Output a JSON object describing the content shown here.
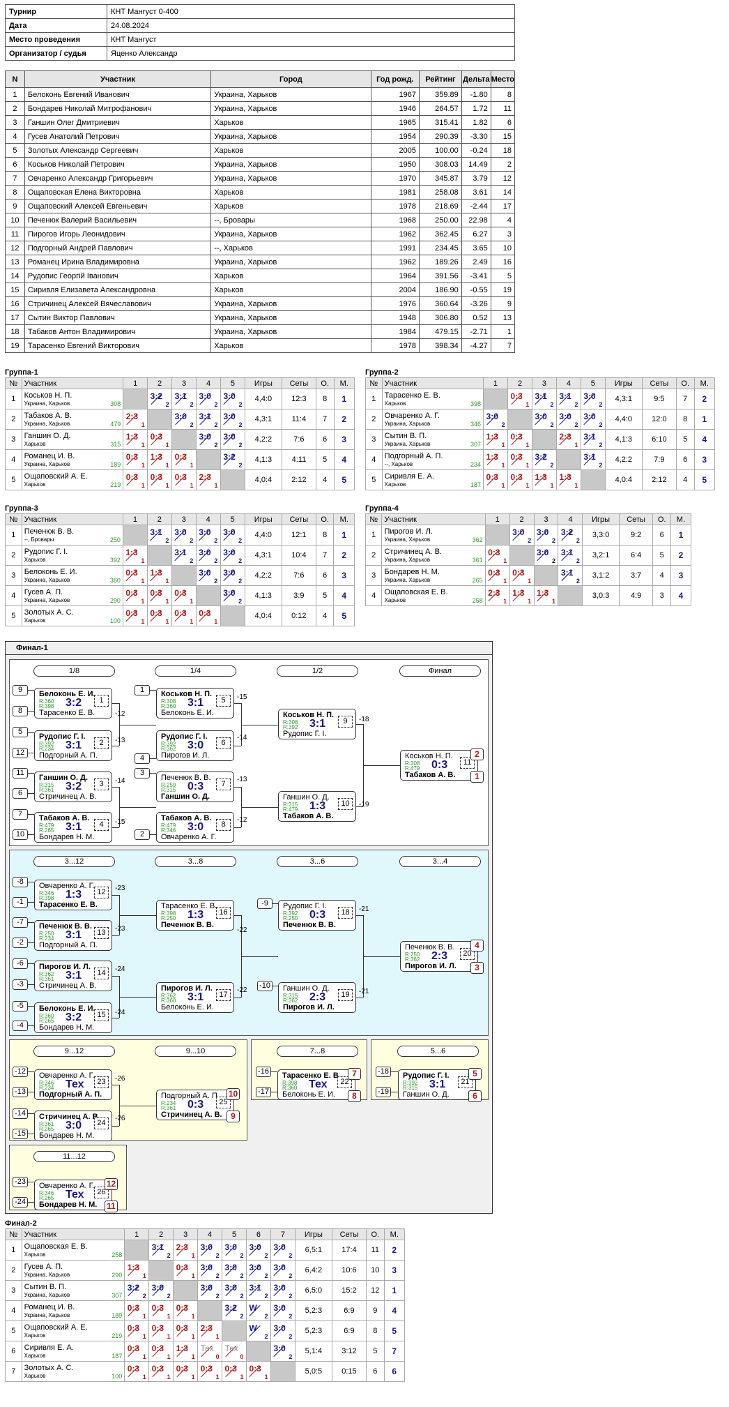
{
  "info": [
    {
      "k": "Турнир",
      "v": "КНТ Мангуст 0-400"
    },
    {
      "k": "Дата",
      "v": "24.08.2024"
    },
    {
      "k": "Место проведения",
      "v": "КНТ Мангуст"
    },
    {
      "k": "Организатор / судья",
      "v": "Яценко Александр"
    }
  ],
  "players_headers": [
    "N",
    "Участник",
    "Город",
    "Год рожд.",
    "Рейтинг",
    "Дельта",
    "Место"
  ],
  "players": [
    [
      "1",
      "Белоконь Евгений Иванович",
      "Украина, Харьков",
      "1967",
      "359.89",
      "-1.80",
      "8"
    ],
    [
      "2",
      "Бондарев Николай Митрофанович",
      "Украина, Харьков",
      "1946",
      "264.57",
      "1.72",
      "11"
    ],
    [
      "3",
      "Ганшин Олег Дмитриевич",
      "Харьков",
      "1965",
      "315.41",
      "1.82",
      "6"
    ],
    [
      "4",
      "Гусев Анатолий Петрович",
      "Украина, Харьков",
      "1954",
      "290.39",
      "-3.30",
      "15"
    ],
    [
      "5",
      "Золотых Александр Сергеевич",
      "Харьков",
      "2005",
      "100.00",
      "-0.24",
      "18"
    ],
    [
      "6",
      "Коськов Николай Петрович",
      "Украина, Харьков",
      "1950",
      "308.03",
      "14.49",
      "2"
    ],
    [
      "7",
      "Овчаренко Александр Григорьевич",
      "Украина, Харьков",
      "1970",
      "345.87",
      "3.79",
      "12"
    ],
    [
      "8",
      "Ощаповская Елена Викторовна",
      "Харьков",
      "1981",
      "258.08",
      "3.61",
      "14"
    ],
    [
      "9",
      "Ощаповский Алексей Евгеньевич",
      "Харьков",
      "1978",
      "218.69",
      "-2.44",
      "17"
    ],
    [
      "10",
      "Печенюк Валерий Васильевич",
      "--, Бровары",
      "1968",
      "250.00",
      "22.98",
      "4"
    ],
    [
      "11",
      "Пирогов Игорь Леонидович",
      "Украина, Харьков",
      "1962",
      "362.45",
      "6.27",
      "3"
    ],
    [
      "12",
      "Подгорный Андрей Павлович",
      "--, Харьков",
      "1991",
      "234.45",
      "3.65",
      "10"
    ],
    [
      "13",
      "Романец Ирина Владимировна",
      "Украина, Харьков",
      "1962",
      "189.26",
      "2.49",
      "16"
    ],
    [
      "14",
      "Рудопис Георгій Іванович",
      "Харьков",
      "1964",
      "391.56",
      "-3.41",
      "5"
    ],
    [
      "15",
      "Сиривля Елизавета Александровна",
      "Харьков",
      "2004",
      "186.90",
      "-0.55",
      "19"
    ],
    [
      "16",
      "Стричинец Алексей Вячеславович",
      "Украина, Харьков",
      "1976",
      "360.64",
      "-3.26",
      "9"
    ],
    [
      "17",
      "Сытин Виктор Павлович",
      "Украина, Харьков",
      "1948",
      "306.80",
      "0.52",
      "13"
    ],
    [
      "18",
      "Табаков Антон Владимирович",
      "Украина, Харьков",
      "1984",
      "479.15",
      "-2.71",
      "1"
    ],
    [
      "19",
      "Тарасенко Евгений Викторович",
      "Харьков",
      "1978",
      "398.34",
      "-4.27",
      "7"
    ]
  ],
  "grp_head": {
    "n": "№",
    "p": "Участник",
    "g": "Игры",
    "s": "Сеты",
    "o": "О.",
    "m": "М."
  },
  "groups": [
    {
      "title": "Группа-1",
      "cols": [
        "1",
        "2",
        "3",
        "4",
        "5"
      ],
      "rows": [
        {
          "n": "1",
          "name": "Коськов Н. П.",
          "city": "Украина, Харьков",
          "r": "308",
          "cells": [
            "",
            "3:2|2",
            "3:1|2",
            "3:0|2",
            "3:0|2"
          ],
          "g": "4,4:0",
          "s": "12:3",
          "o": "8",
          "m": "1"
        },
        {
          "n": "2",
          "name": "Табаков А. В.",
          "city": "Украина, Харьков",
          "r": "479",
          "cells": [
            "2:3|1",
            "",
            "3:0|2",
            "3:1|2",
            "3:0|2"
          ],
          "g": "4,3:1",
          "s": "11:4",
          "o": "7",
          "m": "2"
        },
        {
          "n": "3",
          "name": "Ганшин О. Д.",
          "city": "Харьков",
          "r": "315",
          "cells": [
            "1:3|1",
            "0:3|1",
            "",
            "3:0|2",
            "3:0|2"
          ],
          "g": "4,2:2",
          "s": "7:6",
          "o": "6",
          "m": "3"
        },
        {
          "n": "4",
          "name": "Романец И. В.",
          "city": "Украина, Харьков",
          "r": "189",
          "cells": [
            "0:3|1",
            "1:3|1",
            "0:3|1",
            "",
            "3:2|2"
          ],
          "g": "4,1:3",
          "s": "4:11",
          "o": "5",
          "m": "4"
        },
        {
          "n": "5",
          "name": "Ощаповский А. Е.",
          "city": "Харьков",
          "r": "219",
          "cells": [
            "0:3|1",
            "0:3|1",
            "0:3|1",
            "2:3|1",
            ""
          ],
          "g": "4,0:4",
          "s": "2:12",
          "o": "4",
          "m": "5"
        }
      ]
    },
    {
      "title": "Группа-2",
      "cols": [
        "1",
        "2",
        "3",
        "4",
        "5"
      ],
      "rows": [
        {
          "n": "1",
          "name": "Тарасенко Е. В.",
          "city": "Харьков",
          "r": "398",
          "cells": [
            "",
            "0:3|1",
            "3:1|2",
            "3:1|2",
            "3:0|2"
          ],
          "g": "4,3:1",
          "s": "9:5",
          "o": "7",
          "m": "2"
        },
        {
          "n": "2",
          "name": "Овчаренко А. Г.",
          "city": "Украина, Харьков",
          "r": "346",
          "cells": [
            "3:0|2",
            "",
            "3:0|2",
            "3:0|2",
            "3:0|2"
          ],
          "g": "4,4:0",
          "s": "12:0",
          "o": "8",
          "m": "1"
        },
        {
          "n": "3",
          "name": "Сытин В. П.",
          "city": "Украина, Харьков",
          "r": "307",
          "cells": [
            "1:3|1",
            "0:3|1",
            "",
            "2:3|1",
            "3:1|2"
          ],
          "g": "4,1:3",
          "s": "6:10",
          "o": "5",
          "m": "4"
        },
        {
          "n": "4",
          "name": "Подгорный А. П.",
          "city": "--, Харьков",
          "r": "234",
          "cells": [
            "1:3|1",
            "0:3|1",
            "3:2|2",
            "",
            "3:1|2"
          ],
          "g": "4,2:2",
          "s": "7:9",
          "o": "6",
          "m": "3"
        },
        {
          "n": "5",
          "name": "Сиривля Е. А.",
          "city": "Харьков",
          "r": "187",
          "cells": [
            "0:3|1",
            "0:3|1",
            "1:3|1",
            "1:3|1",
            ""
          ],
          "g": "4,0:4",
          "s": "2:12",
          "o": "4",
          "m": "5"
        }
      ]
    },
    {
      "title": "Группа-3",
      "cols": [
        "1",
        "2",
        "3",
        "4",
        "5"
      ],
      "rows": [
        {
          "n": "1",
          "name": "Печенюк В. В.",
          "city": "--, Бровары",
          "r": "250",
          "cells": [
            "",
            "3:1|2",
            "3:0|2",
            "3:0|2",
            "3:0|2"
          ],
          "g": "4,4:0",
          "s": "12:1",
          "o": "8",
          "m": "1"
        },
        {
          "n": "2",
          "name": "Рудопис Г. І.",
          "city": "Харьков",
          "r": "392",
          "cells": [
            "1:3|1",
            "",
            "3:1|2",
            "3:0|2",
            "3:0|2"
          ],
          "g": "4,3:1",
          "s": "10:4",
          "o": "7",
          "m": "2"
        },
        {
          "n": "3",
          "name": "Белоконь Е. И.",
          "city": "Украина, Харьков",
          "r": "360",
          "cells": [
            "0:3|1",
            "1:3|1",
            "",
            "3:0|2",
            "3:0|2"
          ],
          "g": "4,2:2",
          "s": "7:6",
          "o": "6",
          "m": "3"
        },
        {
          "n": "4",
          "name": "Гусев А. П.",
          "city": "Украина, Харьков",
          "r": "290",
          "cells": [
            "0:3|1",
            "0:3|1",
            "0:3|1",
            "",
            "3:0|2"
          ],
          "g": "4,1:3",
          "s": "3:9",
          "o": "5",
          "m": "4"
        },
        {
          "n": "5",
          "name": "Золотых А. С.",
          "city": "Харьков",
          "r": "100",
          "cells": [
            "0:3|1",
            "0:3|1",
            "0:3|1",
            "0:3|1",
            ""
          ],
          "g": "4,0:4",
          "s": "0:12",
          "o": "4",
          "m": "5"
        }
      ]
    },
    {
      "title": "Группа-4",
      "cols": [
        "1",
        "2",
        "3",
        "4"
      ],
      "rows": [
        {
          "n": "1",
          "name": "Пирогов И. Л.",
          "city": "Украина, Харьков",
          "r": "362",
          "cells": [
            "",
            "3:0|2",
            "3:0|2",
            "3:2|2"
          ],
          "g": "3,3:0",
          "s": "9:2",
          "o": "6",
          "m": "1"
        },
        {
          "n": "2",
          "name": "Стричинец А. В.",
          "city": "Украина, Харьков",
          "r": "361",
          "cells": [
            "0:3|1",
            "",
            "3:0|2",
            "3:1|2"
          ],
          "g": "3,2:1",
          "s": "6:4",
          "o": "5",
          "m": "2"
        },
        {
          "n": "3",
          "name": "Бондарев Н. М.",
          "city": "Украина, Харьков",
          "r": "265",
          "cells": [
            "0:3|1",
            "0:3|1",
            "",
            "3:1|2"
          ],
          "g": "3,1:2",
          "s": "3:7",
          "o": "4",
          "m": "3"
        },
        {
          "n": "4",
          "name": "Ощаповская Е. В.",
          "city": "Харьков",
          "r": "258",
          "cells": [
            "2:3|1",
            "1:3|1",
            "1:3|1",
            ""
          ],
          "g": "3,0:3",
          "s": "4:9",
          "o": "3",
          "m": "4"
        }
      ]
    },
    {
      "title": "Финал-2",
      "cols": [
        "1",
        "2",
        "3",
        "4",
        "5",
        "6",
        "7"
      ],
      "rows": [
        {
          "n": "1",
          "name": "Ощаповская Е. В.",
          "city": "Харьков",
          "r": "258",
          "cells": [
            "",
            "3:1|2",
            "2:3|1",
            "3:0|2",
            "3:0|2",
            "3:0|2",
            "3:0|2"
          ],
          "g": "6,5:1",
          "s": "17:4",
          "o": "11",
          "m": "2"
        },
        {
          "n": "2",
          "name": "Гусев А. П.",
          "city": "Украина, Харьков",
          "r": "290",
          "cells": [
            "1:3|1",
            "",
            "0:3|1",
            "3:0|2",
            "3:0|2",
            "3:0|2",
            "3:0|2"
          ],
          "g": "6,4:2",
          "s": "10:6",
          "o": "10",
          "m": "3"
        },
        {
          "n": "3",
          "name": "Сытин В. П.",
          "city": "Украина, Харьков",
          "r": "307",
          "cells": [
            "3:2|2",
            "3:0|2",
            "",
            "3:0|2",
            "3:0|2",
            "3:1|2",
            "3:0|2"
          ],
          "g": "6,5:0",
          "s": "15:2",
          "o": "12",
          "m": "1"
        },
        {
          "n": "4",
          "name": "Романец И. В.",
          "city": "Украина, Харьков",
          "r": "189",
          "cells": [
            "0:3|1",
            "0:3|1",
            "0:3|1",
            "",
            "3:2|2",
            "W|2",
            "3:0|2"
          ],
          "g": "5,2:3",
          "s": "6:9",
          "o": "9",
          "m": "4"
        },
        {
          "n": "5",
          "name": "Ощаповский А. Е.",
          "city": "Харьков",
          "r": "219",
          "cells": [
            "0:3|1",
            "0:3|1",
            "0:3|1",
            "2:3|1",
            "",
            "W|2",
            "3:0|2"
          ],
          "g": "5,2:3",
          "s": "6:9",
          "o": "8",
          "m": "5"
        },
        {
          "n": "6",
          "name": "Сиривля Е. А.",
          "city": "Харьков",
          "r": "187",
          "cells": [
            "0:3|1",
            "0:3|1",
            "1:3|1",
            "Тех|0",
            "Тех|0",
            "",
            "3:0|2"
          ],
          "g": "5,1:4",
          "s": "3:12",
          "o": "5",
          "m": "7"
        },
        {
          "n": "7",
          "name": "Золотых А. С.",
          "city": "Харьков",
          "r": "100",
          "cells": [
            "0:3|1",
            "0:3|1",
            "0:3|1",
            "0:3|1",
            "0:3|1",
            "0:3|1",
            ""
          ],
          "g": "5,0:5",
          "s": "0:15",
          "o": "6",
          "m": "6"
        }
      ]
    }
  ],
  "final1": {
    "title": "Финал-1",
    "rounds": [
      "1/8",
      "1/4",
      "1/2",
      "Финал",
      "3...12",
      "3...8",
      "3...6",
      "3...4",
      "9...12",
      "9...10",
      "7...8",
      "5...6",
      "11...12"
    ],
    "seeds": [
      "9",
      "8",
      "5",
      "12",
      "11",
      "6",
      "7",
      "10",
      "1",
      "4",
      "3",
      "2",
      "-8",
      "-1",
      "-7",
      "-2",
      "-6",
      "-3",
      "-5",
      "-4",
      "-9",
      "-10",
      "-12",
      "-13",
      "-14",
      "-15",
      "-16",
      "-17",
      "-18",
      "-19",
      "-23",
      "-24"
    ],
    "loser_refs": [
      "-12",
      "-13",
      "-14",
      "-15",
      "-15",
      "-14",
      "-13",
      "-12",
      "-18",
      "-19",
      "-23",
      "-23",
      "-24",
      "-24",
      "-22",
      "-22",
      "-21",
      "-21",
      "-26",
      "-26"
    ],
    "matches": [
      {
        "a": "Белоконь Е. И.",
        "b": "Тарасенко Е. В.",
        "r1": "R:360",
        "r2": "R:398",
        "s": "3:2",
        "g": "1",
        "wa": true
      },
      {
        "a": "Рудопис Г. І.",
        "b": "Подгорный А. П.",
        "r1": "R:392",
        "r2": "R:234",
        "s": "3:1",
        "g": "2",
        "wa": true
      },
      {
        "a": "Ганшин О. Д.",
        "b": "Стричинец А. В.",
        "r1": "R:315",
        "r2": "R:361",
        "s": "3:2",
        "g": "3",
        "wa": true
      },
      {
        "a": "Табаков А. В.",
        "b": "Бондарев Н. М.",
        "r1": "R:479",
        "r2": "R:265",
        "s": "3:1",
        "g": "4",
        "wa": true
      },
      {
        "a": "Коськов Н. П.",
        "b": "Белоконь Е. И.",
        "r1": "R:308",
        "r2": "R:360",
        "s": "3:1",
        "g": "5",
        "wa": true
      },
      {
        "a": "Рудопис Г. І.",
        "b": "Пирогов И. Л.",
        "r1": "R:392",
        "r2": "R:362",
        "s": "3:0",
        "g": "6",
        "wa": true
      },
      {
        "a": "Печенюк В. В.",
        "b": "Ганшин О. Д.",
        "r1": "R:250",
        "r2": "R:315",
        "s": "0:3",
        "g": "7",
        "wa": false
      },
      {
        "a": "Табаков А. В.",
        "b": "Овчаренко А. Г.",
        "r1": "R:479",
        "r2": "R:346",
        "s": "3:0",
        "g": "8",
        "wa": true
      },
      {
        "a": "Коськов Н. П.",
        "b": "Рудопис Г. І.",
        "r1": "R:308",
        "r2": "R:392",
        "s": "3:1",
        "g": "9",
        "wa": true
      },
      {
        "a": "Ганшин О. Д.",
        "b": "Табаков А. В.",
        "r1": "R:315",
        "r2": "R:479",
        "s": "1:3",
        "g": "10",
        "wa": false
      },
      {
        "a": "Коськов Н. П.",
        "b": "Табаков А. В.",
        "r1": "R:308",
        "r2": "R:479",
        "s": "0:3",
        "g": "11",
        "wa": false,
        "pa": "2",
        "pb": "1"
      },
      {
        "a": "Овчаренко А. Г.",
        "b": "Тарасенко Е. В.",
        "r1": "R:346",
        "r2": "R:398",
        "s": "1:3",
        "g": "12",
        "wa": false
      },
      {
        "a": "Печенюк В. В.",
        "b": "Подгорный А. П.",
        "r1": "R:250",
        "r2": "R:234",
        "s": "3:1",
        "g": "13",
        "wa": true
      },
      {
        "a": "Пирогов И. Л.",
        "b": "Стричинец А. В.",
        "r1": "R:362",
        "r2": "R:361",
        "s": "3:1",
        "g": "14",
        "wa": true
      },
      {
        "a": "Белоконь Е. И.",
        "b": "Бондарев Н. М.",
        "r1": "R:360",
        "r2": "R:265",
        "s": "3:2",
        "g": "15",
        "wa": true
      },
      {
        "a": "Тарасенко Е. В.",
        "b": "Печенюк В. В.",
        "r1": "R:398",
        "r2": "R:250",
        "s": "1:3",
        "g": "16",
        "wa": false
      },
      {
        "a": "Пирогов И. Л.",
        "b": "Белоконь Е. И.",
        "r1": "R:362",
        "r2": "R:360",
        "s": "3:1",
        "g": "17",
        "wa": true
      },
      {
        "a": "Рудопис Г. І.",
        "b": "Печенюк В. В.",
        "r1": "R:392",
        "r2": "R:250",
        "s": "0:3",
        "g": "18",
        "wa": false
      },
      {
        "a": "Ганшин О. Д.",
        "b": "Пирогов И. Л.",
        "r1": "R:315",
        "r2": "R:362",
        "s": "2:3",
        "g": "19",
        "wa": false
      },
      {
        "a": "Печенюк В. В.",
        "b": "Пирогов И. Л.",
        "r1": "R:250",
        "r2": "R:362",
        "s": "2:3",
        "g": "20",
        "wa": false,
        "pa": "4",
        "pb": "3"
      },
      {
        "a": "Овчаренко А. Г.",
        "b": "Подгорный А. П.",
        "r1": "R:346",
        "r2": "R:234",
        "s": "Тех",
        "g": "23",
        "wa": false
      },
      {
        "a": "Стричинец А. В.",
        "b": "Бондарев Н. М.",
        "r1": "R:361",
        "r2": "R:265",
        "s": "3:0",
        "g": "24",
        "wa": true
      },
      {
        "a": "Подгорный А. П.",
        "b": "Стричинец А. В.",
        "r1": "R:234",
        "r2": "R:361",
        "s": "0:3",
        "g": "25",
        "wa": false,
        "pa": "10",
        "pb": "9"
      },
      {
        "a": "Тарасенко Е. В.",
        "b": "Белоконь Е. И.",
        "r1": "R:398",
        "r2": "R:360",
        "s": "Тех",
        "g": "22",
        "wa": true,
        "pa": "7",
        "pb": "8"
      },
      {
        "a": "Рудопис Г. І.",
        "b": "Ганшин О. Д.",
        "r1": "R:392",
        "r2": "R:315",
        "s": "3:1",
        "g": "21",
        "wa": true,
        "pa": "5",
        "pb": "6"
      },
      {
        "a": "Овчаренко А. Г.",
        "b": "Бондарев Н. М.",
        "r1": "R:346",
        "r2": "R:265",
        "s": "Тех",
        "g": "26",
        "wa": false,
        "pa": "12",
        "pb": "11"
      }
    ]
  }
}
